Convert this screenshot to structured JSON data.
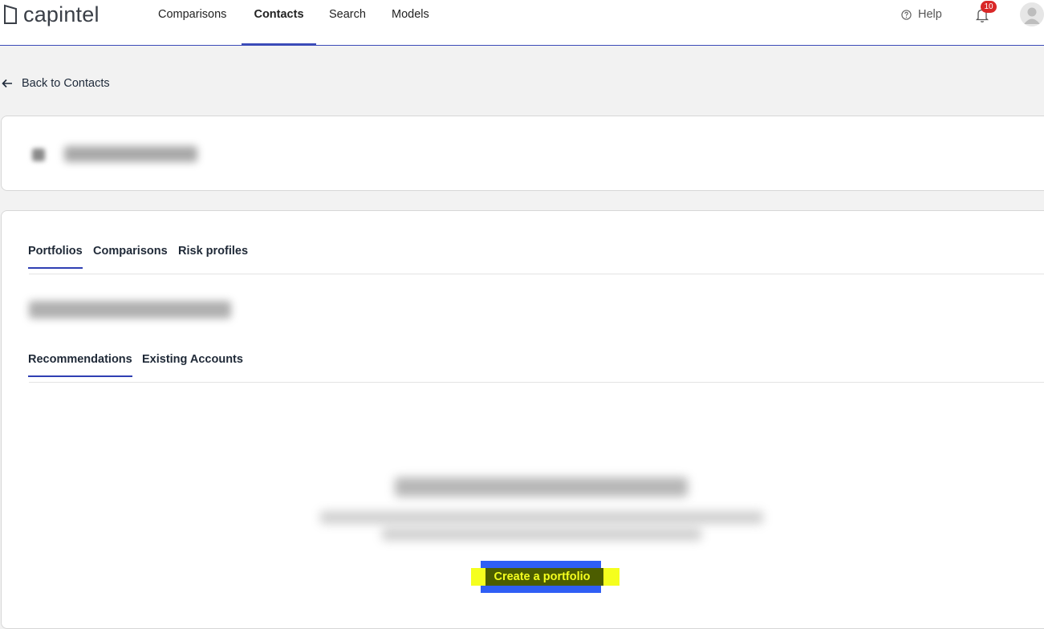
{
  "brand": {
    "name": "capintel",
    "color": "#3a3f47"
  },
  "nav": {
    "items": [
      {
        "label": "Comparisons",
        "active": false
      },
      {
        "label": "Contacts",
        "active": true
      },
      {
        "label": "Search",
        "active": false
      },
      {
        "label": "Models",
        "active": false
      }
    ],
    "help_label": "Help",
    "notification_count": "10",
    "accent": "#3b4bb8"
  },
  "back_link": {
    "label": "Back to Contacts",
    "icon": "arrow-left-icon"
  },
  "tabs": [
    {
      "label": "Portfolios",
      "active": true
    },
    {
      "label": "Comparisons",
      "active": false
    },
    {
      "label": "Risk profiles",
      "active": false
    }
  ],
  "subtabs": [
    {
      "label": "Recommendations",
      "active": true
    },
    {
      "label": "Existing Accounts",
      "active": false
    }
  ],
  "empty_state": {
    "button_label": "Create a portfolio"
  }
}
